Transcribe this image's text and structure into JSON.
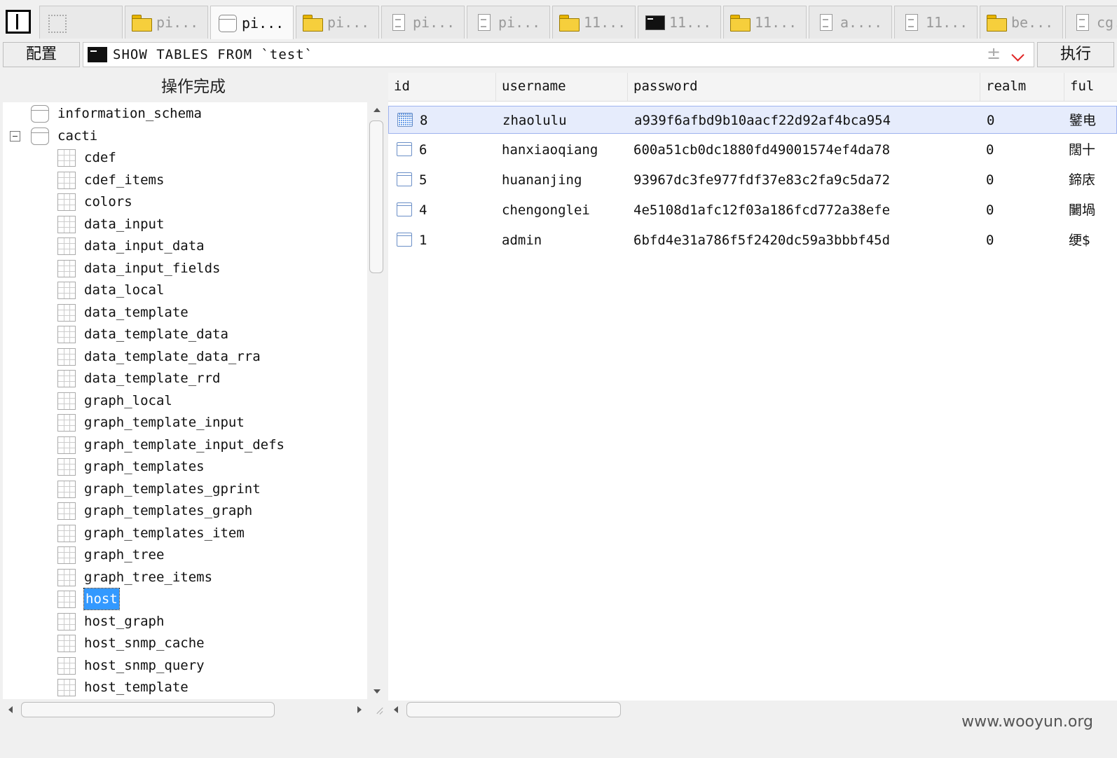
{
  "tabs": [
    {
      "label": "",
      "icon": "dotted-icon",
      "active": false
    },
    {
      "label": "pi...",
      "icon": "folder-icon",
      "active": false
    },
    {
      "label": "pi...",
      "icon": "database-icon",
      "active": true
    },
    {
      "label": "pi...",
      "icon": "folder-icon",
      "active": false
    },
    {
      "label": "pi...",
      "icon": "document-icon",
      "active": false
    },
    {
      "label": "pi...",
      "icon": "document-icon",
      "active": false
    },
    {
      "label": "11...",
      "icon": "folder-icon",
      "active": false
    },
    {
      "label": "11...",
      "icon": "terminal-icon",
      "active": false
    },
    {
      "label": "11...",
      "icon": "folder-icon",
      "active": false
    },
    {
      "label": "a....",
      "icon": "document-icon",
      "active": false
    },
    {
      "label": "11...",
      "icon": "document-icon",
      "active": false
    },
    {
      "label": "be...",
      "icon": "folder-icon",
      "active": false
    },
    {
      "label": "cg...",
      "icon": "document-icon",
      "active": false
    }
  ],
  "toolbar": {
    "config_label": "配置",
    "query": "SHOW TABLES FROM `test`",
    "execute_label": "执行"
  },
  "status_text": "操作完成",
  "tree": {
    "databases": [
      {
        "name": "information_schema",
        "expanded": false
      },
      {
        "name": "cacti",
        "expanded": true
      }
    ],
    "tables": [
      "cdef",
      "cdef_items",
      "colors",
      "data_input",
      "data_input_data",
      "data_input_fields",
      "data_local",
      "data_template",
      "data_template_data",
      "data_template_data_rra",
      "data_template_rrd",
      "graph_local",
      "graph_template_input",
      "graph_template_input_defs",
      "graph_templates",
      "graph_templates_gprint",
      "graph_templates_graph",
      "graph_templates_item",
      "graph_tree",
      "graph_tree_items",
      "host",
      "host_graph",
      "host_snmp_cache",
      "host_snmp_query",
      "host_template"
    ],
    "selected_table": "host"
  },
  "grid": {
    "columns": [
      "id",
      "username",
      "password",
      "realm",
      "ful"
    ],
    "rows": [
      {
        "id": "8",
        "username": "zhaolulu",
        "password": "a939f6afbd9b10aacf22d92af4bca954",
        "realm": "0",
        "full": "鐾电",
        "selected": true
      },
      {
        "id": "6",
        "username": "hanxiaoqiang",
        "password": "600a51cb0dc1880fd49001574ef4da78",
        "realm": "0",
        "full": "闊十",
        "selected": false
      },
      {
        "id": "5",
        "username": "huananjing",
        "password": "93967dc3fe977fdf37e83c2fa9c5da72",
        "realm": "0",
        "full": "鍗庡",
        "selected": false
      },
      {
        "id": "4",
        "username": "chengonglei",
        "password": "4e5108d1afc12f03a186fcd772a38efe",
        "realm": "0",
        "full": "闄堝",
        "selected": false
      },
      {
        "id": "1",
        "username": "admin",
        "password": "6bfd4e31a786f5f2420dc59a3bbbf45d",
        "realm": "0",
        "full": "绠$",
        "selected": false
      }
    ]
  },
  "watermark": "www.wooyun.org"
}
